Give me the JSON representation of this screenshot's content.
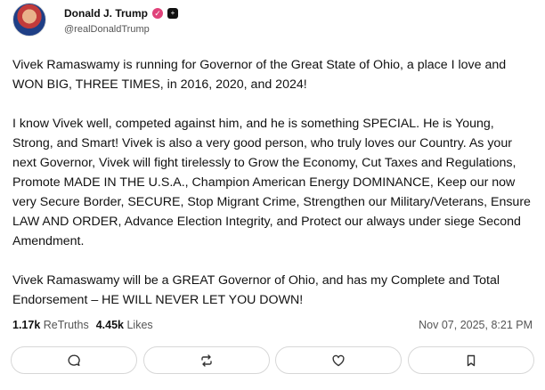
{
  "author": {
    "display_name": "Donald J. Trump",
    "handle": "@realDonaldTrump",
    "verified_icon": "verified-badge-icon",
    "extra_badge_icon": "plus-badge-icon"
  },
  "post": {
    "text": "Vivek Ramaswamy is running for Governor of the Great State of Ohio, a place I love and WON BIG, THREE TIMES, in 2016, 2020, and 2024!\n\nI know Vivek well, competed against him, and he is something SPECIAL. He is Young, Strong, and Smart! Vivek is also a very good person, who truly loves our Country. As your next Governor, Vivek will fight tirelessly to Grow the Economy, Cut Taxes and Regulations, Promote MADE IN THE U.S.A., Champion American Energy DOMINANCE, Keep our now very Secure Border, SECURE, Stop Migrant Crime, Strengthen our Military/Veterans, Ensure LAW AND ORDER, Advance Election Integrity, and Protect our always under siege Second Amendment.\n\nVivek Ramaswamy will be a GREAT Governor of Ohio, and has my Complete and Total Endorsement – HE WILL NEVER LET YOU DOWN!"
  },
  "stats": {
    "retruths_count": "1.17k",
    "retruths_label": "ReTruths",
    "likes_count": "4.45k",
    "likes_label": "Likes"
  },
  "timestamp": "Nov 07, 2025, 8:21 PM",
  "actions": {
    "reply_icon": "reply-icon",
    "retruth_icon": "retruth-icon",
    "like_icon": "heart-icon",
    "bookmark_icon": "bookmark-icon"
  }
}
